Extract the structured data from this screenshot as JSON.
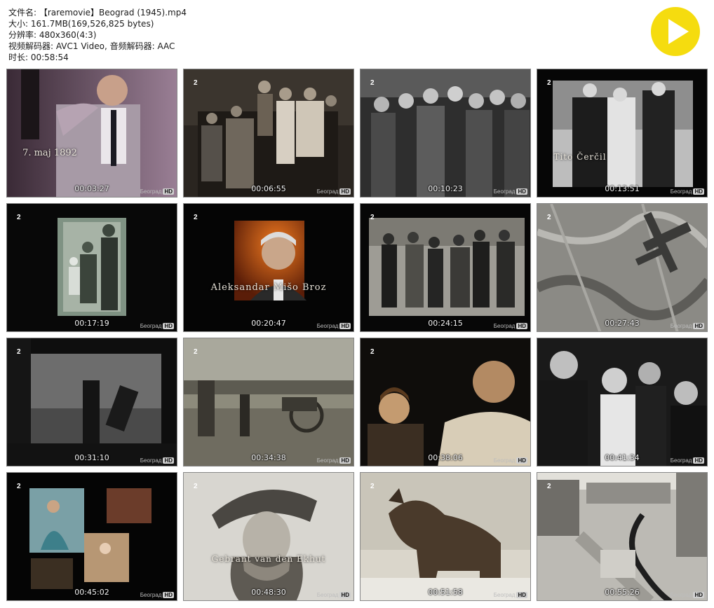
{
  "file_info": {
    "name_line": "文件名: 【raremovie】Beograd (1945).mp4",
    "size_line": "大小: 161.7MB(169,526,825 bytes)",
    "resolution_line": "分辨率: 480x360(4:3)",
    "codec_line": "视频解码器: AVC1 Video, 音频解码器: AAC",
    "duration_line": "时长: 00:58:54"
  },
  "play_button": {
    "icon": "play-icon",
    "color": "#f5dc0f"
  },
  "thumbnails": [
    {
      "time": "00:03:27",
      "caption": "7. maj 1892"
    },
    {
      "time": "00:06:55"
    },
    {
      "time": "00:10:23"
    },
    {
      "time": "00:13:51",
      "caption": "Tito   Čerčil"
    },
    {
      "time": "00:17:19"
    },
    {
      "time": "00:20:47",
      "caption": "Aleksandar Mišo Broz"
    },
    {
      "time": "00:24:15"
    },
    {
      "time": "00:27:43"
    },
    {
      "time": "00:31:10"
    },
    {
      "time": "00:34:38"
    },
    {
      "time": "00:38:06"
    },
    {
      "time": "00:41:34"
    },
    {
      "time": "00:45:02"
    },
    {
      "time": "00:48:30",
      "caption": "Gebrant van den Ekhut"
    },
    {
      "time": "00:51:58"
    },
    {
      "time": "00:55:26"
    }
  ],
  "overlay": {
    "channel": "2",
    "watermark": "Београд",
    "hd_badge": "HD"
  }
}
